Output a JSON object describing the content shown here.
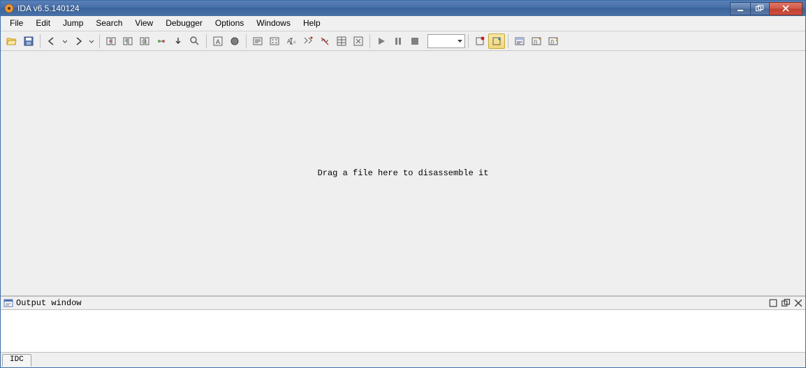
{
  "title": "IDA v6.5.140124",
  "menu": [
    "File",
    "Edit",
    "Jump",
    "Search",
    "View",
    "Debugger",
    "Options",
    "Windows",
    "Help"
  ],
  "main_message": "Drag a file here to disassemble it",
  "output": {
    "title": "Output window"
  },
  "bottom_tab": "IDC",
  "toolbar": {
    "groups": [
      [
        "open",
        "save"
      ],
      [
        "back",
        "back-drop",
        "forward",
        "forward-drop"
      ],
      [
        "nav1",
        "nav2",
        "nav3",
        "nav4",
        "down-arrow",
        "search-tb"
      ],
      [
        "text-view",
        "mark"
      ],
      [
        "code1",
        "code2",
        "rename",
        "xref",
        "nofunc",
        "struct",
        "enum"
      ],
      [
        "run",
        "pause",
        "stop",
        "debugger-combo"
      ],
      [
        "bp1",
        "bp2"
      ],
      [
        "win1",
        "win2",
        "win3"
      ]
    ]
  }
}
